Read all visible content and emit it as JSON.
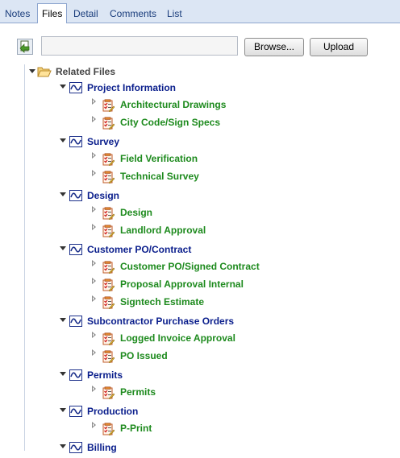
{
  "tabs": [
    {
      "label": "Notes",
      "active": false
    },
    {
      "label": "Files",
      "active": true
    },
    {
      "label": "Detail",
      "active": false
    },
    {
      "label": "Comments",
      "active": false
    },
    {
      "label": "List",
      "active": false
    }
  ],
  "upload": {
    "file_value": "",
    "browse_label": "Browse...",
    "upload_label": "Upload"
  },
  "tree": {
    "root_label": "Related Files",
    "categories": [
      {
        "label": "Project Information",
        "items": [
          "Architectural Drawings",
          "City Code/Sign Specs"
        ]
      },
      {
        "label": "Survey",
        "items": [
          "Field Verification",
          "Technical Survey"
        ]
      },
      {
        "label": "Design",
        "items": [
          "Design",
          "Landlord Approval"
        ]
      },
      {
        "label": "Customer PO/Contract",
        "items": [
          "Customer PO/Signed Contract",
          "Proposal Approval Internal",
          "Signtech Estimate"
        ]
      },
      {
        "label": "Subcontractor Purchase Orders",
        "items": [
          "Logged Invoice Approval",
          "PO Issued"
        ]
      },
      {
        "label": "Permits",
        "items": [
          "Permits"
        ]
      },
      {
        "label": "Production",
        "items": [
          "P-Print"
        ]
      },
      {
        "label": "Billing",
        "items": []
      }
    ]
  },
  "colors": {
    "tab_bar": "#dce6f4",
    "category_text": "#0a1e8c",
    "item_text": "#1d8a1d",
    "root_text": "#444444"
  },
  "icons": {
    "root": "folder-open-icon",
    "category": "category-wave-icon",
    "item": "file-checklist-icon",
    "upload": "upload-file-icon"
  }
}
